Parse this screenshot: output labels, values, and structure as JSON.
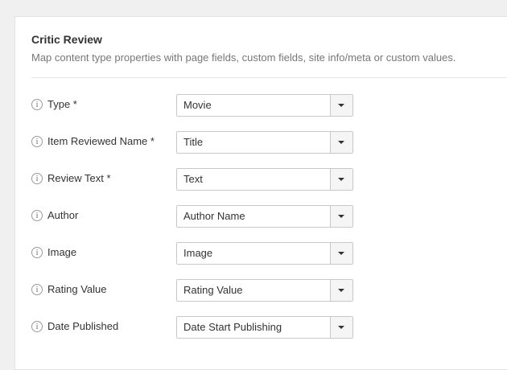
{
  "section": {
    "title": "Critic Review",
    "description": "Map content type properties with page fields, custom fields, site info/meta or custom values."
  },
  "info_glyph": "i",
  "fields": [
    {
      "label": "Type *",
      "value": "Movie"
    },
    {
      "label": "Item Reviewed Name *",
      "value": "Title"
    },
    {
      "label": "Review Text *",
      "value": "Text"
    },
    {
      "label": "Author",
      "value": "Author Name"
    },
    {
      "label": "Image",
      "value": "Image"
    },
    {
      "label": "Rating Value",
      "value": "Rating Value"
    },
    {
      "label": "Date Published",
      "value": "Date Start Publishing"
    }
  ]
}
